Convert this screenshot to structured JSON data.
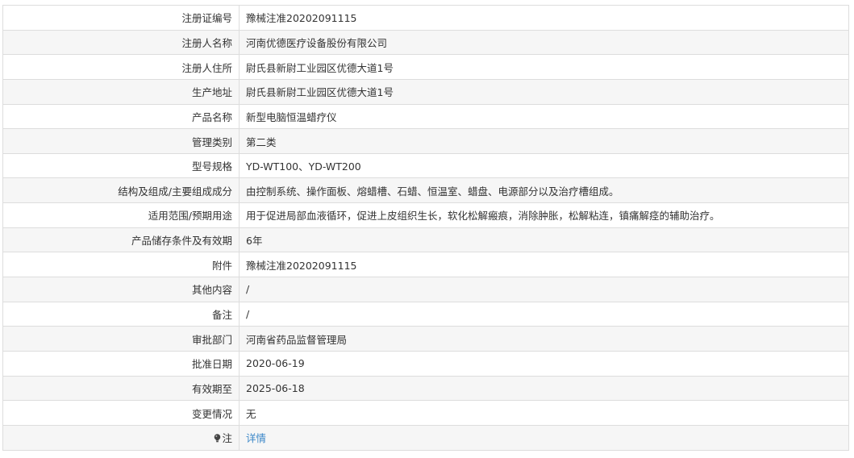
{
  "rows": [
    {
      "label": "注册证编号",
      "value": "豫械注准20202091115"
    },
    {
      "label": "注册人名称",
      "value": "河南优德医疗设备股份有限公司"
    },
    {
      "label": "注册人住所",
      "value": "尉氏县新尉工业园区优德大道1号"
    },
    {
      "label": "生产地址",
      "value": "尉氏县新尉工业园区优德大道1号"
    },
    {
      "label": "产品名称",
      "value": "新型电脑恒温蜡疗仪"
    },
    {
      "label": "管理类别",
      "value": "第二类"
    },
    {
      "label": "型号规格",
      "value": "YD-WT100、YD-WT200"
    },
    {
      "label": "结构及组成/主要组成成分",
      "value": "由控制系统、操作面板、熔蜡槽、石蜡、恒温室、蜡盘、电源部分以及治疗槽组成。"
    },
    {
      "label": "适用范围/预期用途",
      "value": "用于促进局部血液循环，促进上皮组织生长，软化松解瘢痕，消除肿胀，松解粘连，镇痛解痉的辅助治疗。"
    },
    {
      "label": "产品储存条件及有效期",
      "value": "6年"
    },
    {
      "label": "附件",
      "value": "豫械注准20202091115"
    },
    {
      "label": "其他内容",
      "value": "/"
    },
    {
      "label": "备注",
      "value": "/"
    },
    {
      "label": "审批部门",
      "value": "河南省药品监督管理局"
    },
    {
      "label": "批准日期",
      "value": "2020-06-19"
    },
    {
      "label": "有效期至",
      "value": "2025-06-18"
    },
    {
      "label": "变更情况",
      "value": "无"
    }
  ],
  "note_row": {
    "icon": "bulb-icon",
    "label": "注",
    "link_text": "详情"
  },
  "colors": {
    "border": "#dddddd",
    "alt_row_bg": "#f6f6f6",
    "text": "#333333",
    "link": "#3b87c8"
  }
}
